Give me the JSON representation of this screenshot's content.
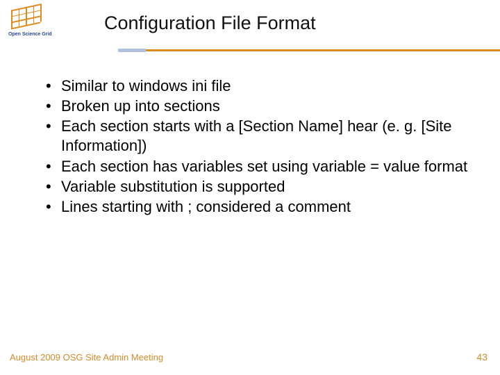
{
  "header": {
    "logo_label": "Open Science Grid",
    "title": "Configuration File Format"
  },
  "bullets": [
    "Similar to windows ini file",
    "Broken up into sections",
    "Each section starts with a [Section Name] hear (e. g. [Site Information])",
    "Each section has variables set using variable = value format",
    "Variable substitution is supported",
    "Lines starting with ; considered a comment"
  ],
  "footer": {
    "left": "August 2009 OSG Site Admin Meeting",
    "page_number": "43"
  }
}
